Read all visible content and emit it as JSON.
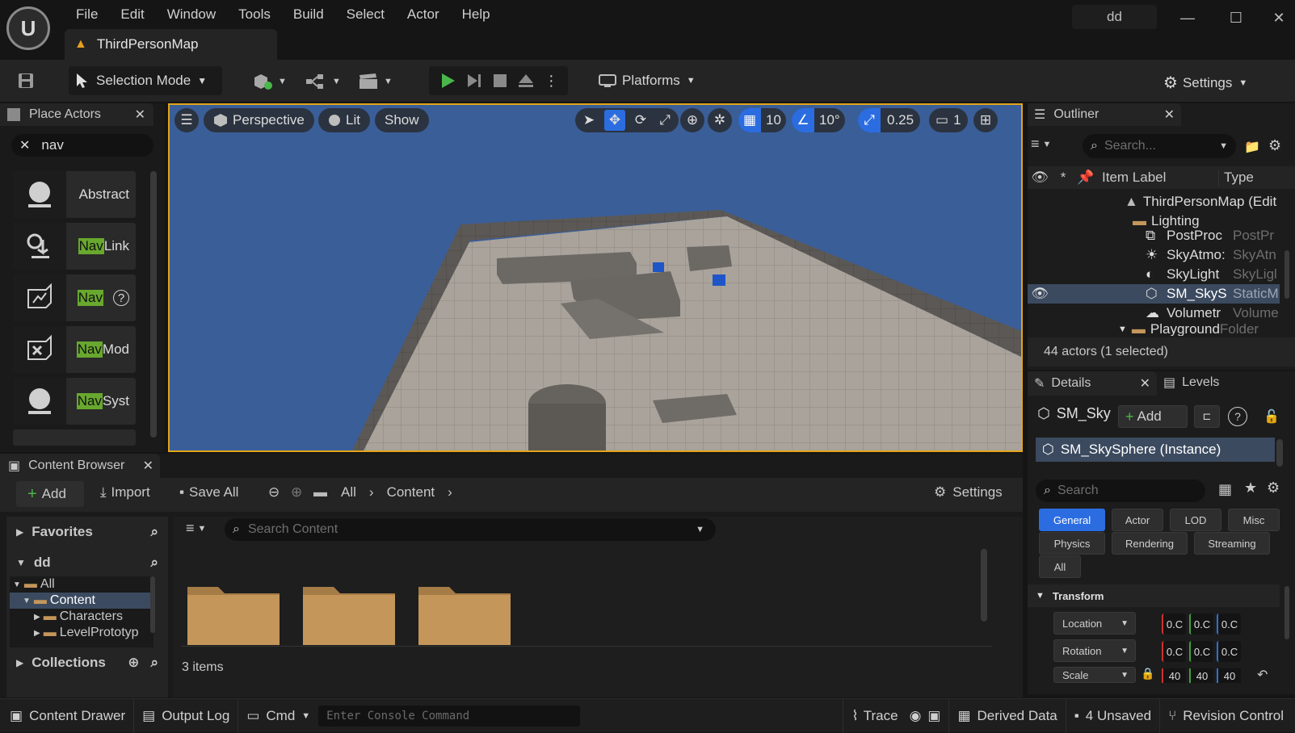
{
  "menu": [
    "File",
    "Edit",
    "Window",
    "Tools",
    "Build",
    "Select",
    "Actor",
    "Help"
  ],
  "level_tab": "ThirdPersonMap",
  "project_name": "dd",
  "toolbar": {
    "selection_mode": "Selection Mode",
    "platforms": "Platforms",
    "settings": "Settings"
  },
  "place_actors": {
    "title": "Place Actors",
    "search_value": "nav",
    "items": [
      {
        "highlight": "",
        "rest": "Abstract"
      },
      {
        "highlight": "Nav",
        "rest": " Link"
      },
      {
        "highlight": "Nav",
        "rest": ""
      },
      {
        "highlight": "Nav",
        "rest": " Mod"
      },
      {
        "highlight": "Nav",
        "rest": " Syst"
      }
    ]
  },
  "viewport": {
    "perspective": "Perspective",
    "lit": "Lit",
    "show": "Show",
    "grid_snap": "10",
    "rotation_snap": "10°",
    "scale_snap": "0.25",
    "camera_speed": "1"
  },
  "outliner": {
    "title": "Outliner",
    "search_placeholder": "Search...",
    "col_label": "Item Label",
    "col_type": "Type",
    "root": "ThirdPersonMap (Edit",
    "folder_lighting": "Lighting",
    "rows": [
      {
        "label": "PostProc",
        "type": "PostPr"
      },
      {
        "label": "SkyAtmo:",
        "type": "SkyAtn"
      },
      {
        "label": "SkyLight",
        "type": "SkyLigl"
      },
      {
        "label": "SM_SkyS",
        "type": "StaticM"
      },
      {
        "label": "Volumetr",
        "type": "Volume"
      }
    ],
    "folder_playground": "Playground",
    "folder_type": "Folder",
    "status": "44 actors (1 selected)"
  },
  "details": {
    "title": "Details",
    "levels_tab": "Levels",
    "actor_name": "SM_Sky",
    "add": "Add",
    "component": "SM_SkySphere (Instance)",
    "search_placeholder": "Search",
    "filters": [
      "General",
      "Actor",
      "LOD",
      "Misc",
      "Physics",
      "Rendering",
      "Streaming",
      "All"
    ],
    "section": "Transform",
    "location": "Location",
    "rotation": "Rotation",
    "scale": "Scale",
    "loc_vals": [
      "0.C",
      "0.C",
      "0.C"
    ],
    "rot_vals": [
      "0.C",
      "0.C",
      "0.C"
    ],
    "scale_vals": [
      "40",
      "40",
      "40"
    ]
  },
  "content_browser": {
    "title": "Content Browser",
    "add": "Add",
    "import": "Import",
    "save_all": "Save All",
    "crumb_all": "All",
    "crumb_content": "Content",
    "settings": "Settings",
    "favorites": "Favorites",
    "project": "dd",
    "tree": [
      "All",
      "Content",
      "Characters",
      "LevelPrototyp"
    ],
    "collections": "Collections",
    "search_placeholder": "Search Content",
    "item_count": "3 items"
  },
  "statusbar": {
    "content_drawer": "Content Drawer",
    "output_log": "Output Log",
    "cmd": "Cmd",
    "console_placeholder": "Enter Console Command",
    "trace": "Trace",
    "derived_data": "Derived Data",
    "unsaved": "4 Unsaved",
    "revision_control": "Revision Control"
  },
  "colors": {
    "accent": "#2b6de0",
    "play": "#4ab74a",
    "selection_border": "#e2a51a",
    "folder": "#c4965a"
  }
}
